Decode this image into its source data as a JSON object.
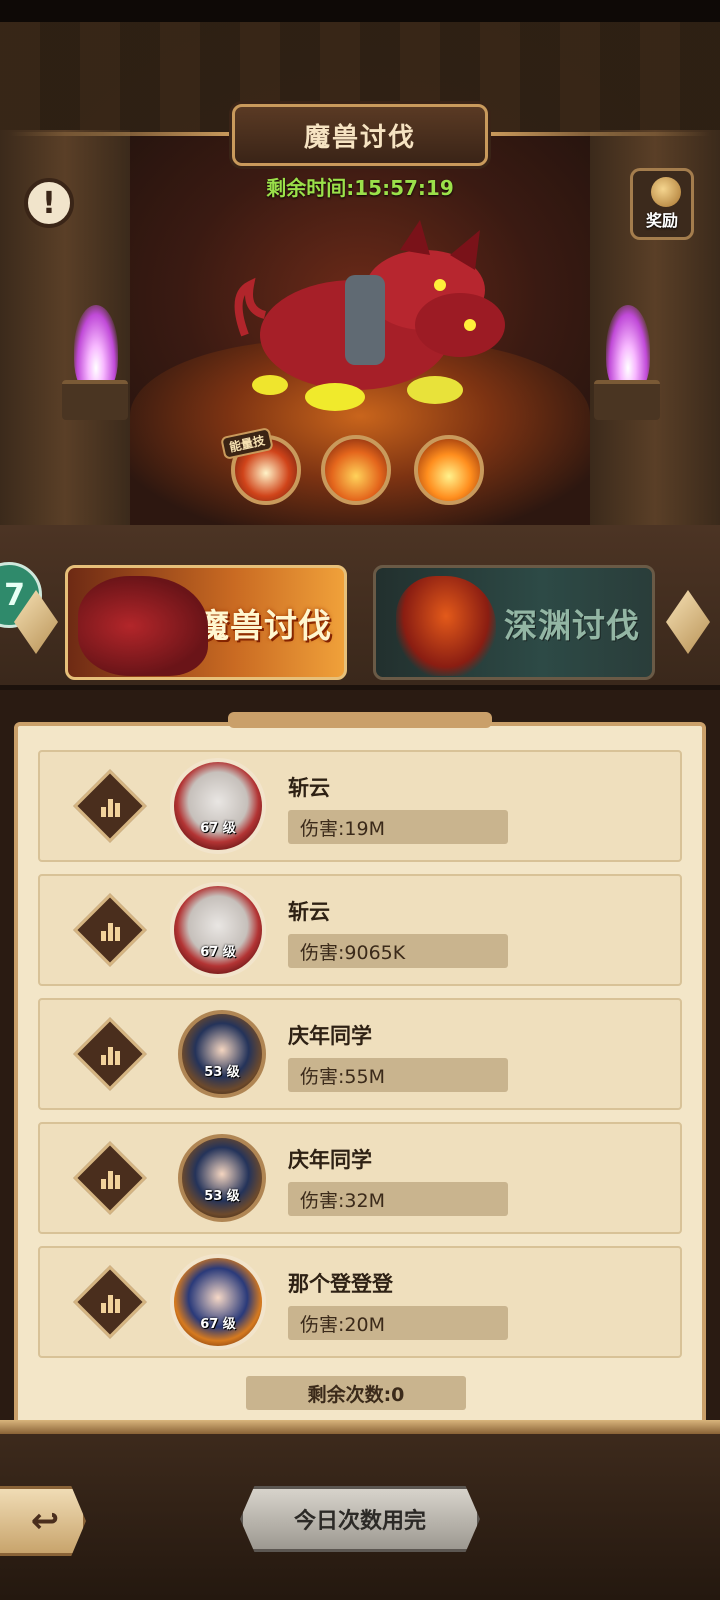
{
  "header": {
    "title": "魔兽讨伐",
    "timer": "剩余时间:15:57:19",
    "info_glyph": "!",
    "reward_label": "奖励"
  },
  "skills": {
    "tag": "能量技",
    "icons": [
      "claw-slash-icon",
      "fire-claw-icon",
      "flame-icon"
    ]
  },
  "modes": {
    "active": "魔兽讨伐",
    "inactive": "深渊讨伐",
    "edge_badge": "7"
  },
  "ranking": [
    {
      "name": "斩云",
      "level": "67 级",
      "damage": "伤害:19M",
      "frame": "red"
    },
    {
      "name": "斩云",
      "level": "67 级",
      "damage": "伤害:9065K",
      "frame": "red"
    },
    {
      "name": "庆年同学",
      "level": "53 级",
      "damage": "伤害:55M",
      "frame": "brown"
    },
    {
      "name": "庆年同学",
      "level": "53 级",
      "damage": "伤害:32M",
      "frame": "brown"
    },
    {
      "name": "那个登登登",
      "level": "67 级",
      "damage": "伤害:20M",
      "frame": "gold"
    }
  ],
  "remaining": "剩余次数:0",
  "footer": {
    "back_glyph": "↩",
    "main_button": "今日次数用完"
  },
  "colors": {
    "timer": "#9be04a",
    "panel": "#f3e6c8",
    "gold_trim": "#caa06a"
  }
}
